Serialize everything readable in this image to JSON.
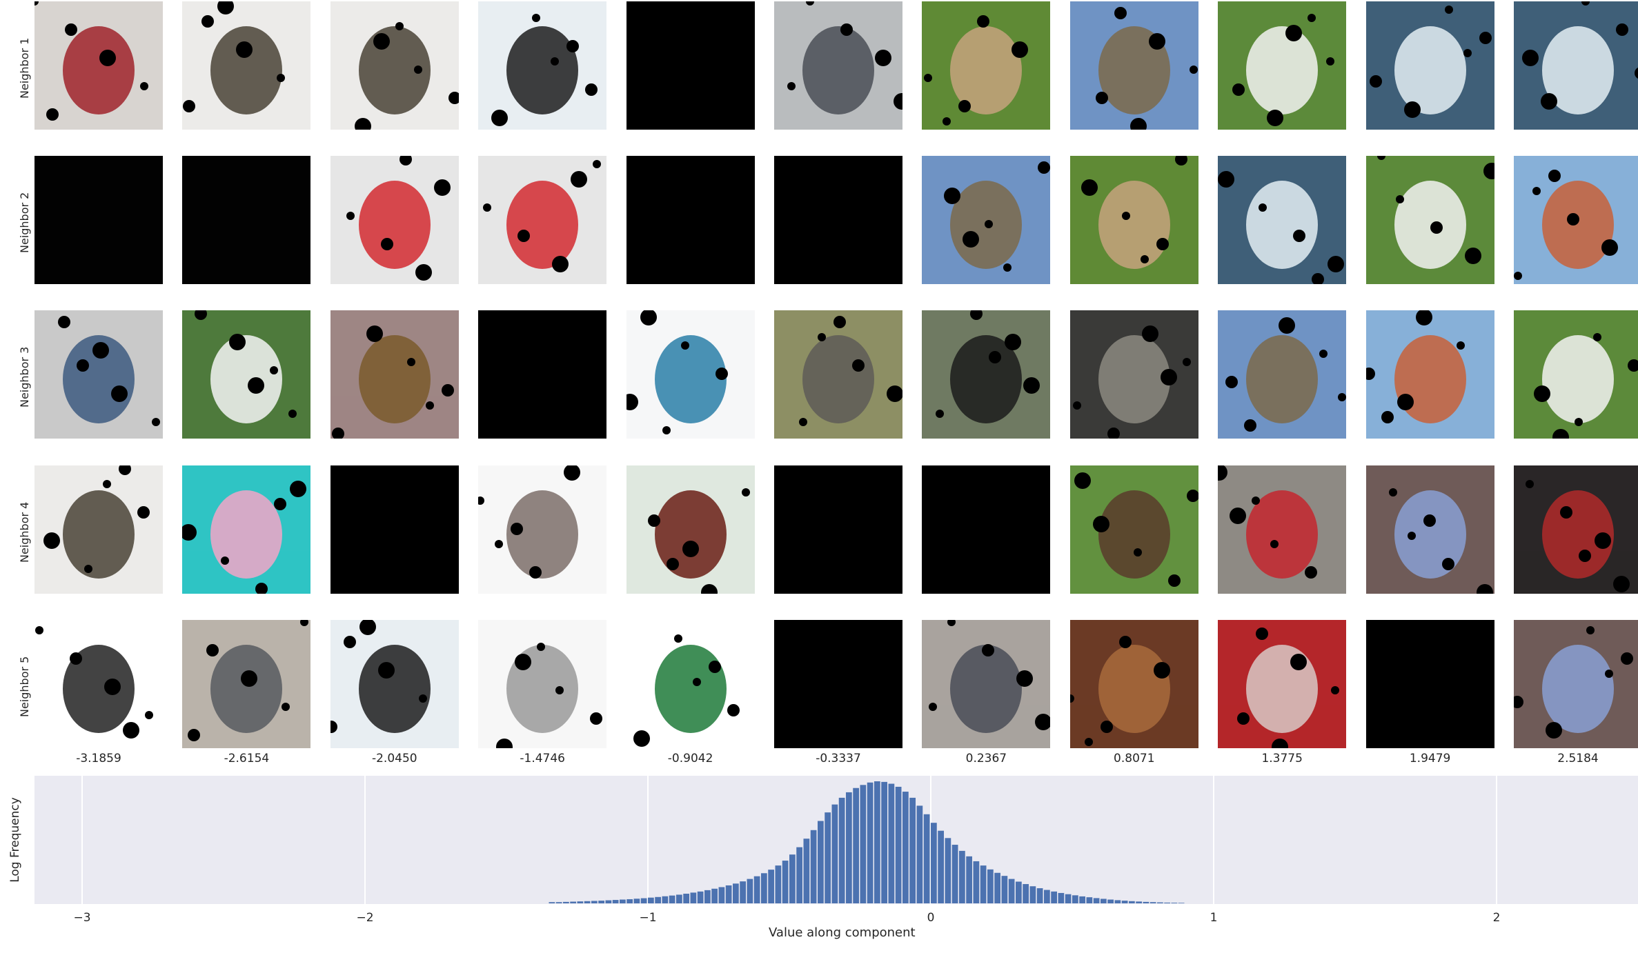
{
  "row_labels": [
    "Neighbor 1",
    "Neighbor 2",
    "Neighbor 3",
    "Neighbor 4",
    "Neighbor 5"
  ],
  "column_values": [
    "-3.1859",
    "-2.6154",
    "-2.0450",
    "-1.4746",
    "-0.9042",
    "-0.3337",
    "0.2367",
    "0.8071",
    "1.3775",
    "1.9479",
    "2.5184"
  ],
  "thumbnails": [
    [
      {
        "icon": "person-jacket-photo",
        "bg": "#d8d4d0",
        "fg": "#a0232b"
      },
      {
        "icon": "costume-figure-photo",
        "bg": "#ecebe9",
        "fg": "#4a4336"
      },
      {
        "icon": "costume-figure-photo",
        "bg": "#ecebe9",
        "fg": "#4a4336"
      },
      {
        "icon": "camera-photo",
        "bg": "#e8eef2",
        "fg": "#1d1d1f"
      },
      {
        "icon": "dark-image",
        "bg": "#000000",
        "fg": "#000000"
      },
      {
        "icon": "street-crowd-photo",
        "bg": "#b9bcbe",
        "fg": "#4a4f57"
      },
      {
        "icon": "dogs-on-grass-photo",
        "bg": "#5f8a35",
        "fg": "#c5a27c"
      },
      {
        "icon": "town-scene-photo",
        "bg": "#6f93c4",
        "fg": "#7d6a4b"
      },
      {
        "icon": "white-dog-photo",
        "bg": "#5c8a3a",
        "fg": "#f2f2f2"
      },
      {
        "icon": "waterfall-photo",
        "bg": "#3f5f78",
        "fg": "#e4eef3"
      },
      {
        "icon": "waterfall-photo",
        "bg": "#3f5f78",
        "fg": "#e4eef3"
      }
    ],
    [
      {
        "icon": "dark-image",
        "bg": "#020202",
        "fg": "#020202"
      },
      {
        "icon": "dark-image",
        "bg": "#020202",
        "fg": "#020202"
      },
      {
        "icon": "tool-package-photo",
        "bg": "#e6e6e6",
        "fg": "#d22a30"
      },
      {
        "icon": "tool-package-photo",
        "bg": "#e6e6e6",
        "fg": "#d22a30"
      },
      {
        "icon": "dark-image",
        "bg": "#000000",
        "fg": "#000000"
      },
      {
        "icon": "dark-image",
        "bg": "#000000",
        "fg": "#000000"
      },
      {
        "icon": "town-scene-photo",
        "bg": "#6f93c4",
        "fg": "#7d6a4b"
      },
      {
        "icon": "dogs-on-grass-photo",
        "bg": "#5f8a35",
        "fg": "#c5a27c"
      },
      {
        "icon": "waterfall-photo",
        "bg": "#3f5f78",
        "fg": "#e4eef3"
      },
      {
        "icon": "white-dog-photo",
        "bg": "#5c8a3a",
        "fg": "#f2f2f2"
      },
      {
        "icon": "castle-painting-photo",
        "bg": "#87b0d8",
        "fg": "#c8623a"
      }
    ],
    [
      {
        "icon": "jeans-photo",
        "bg": "#c9c9c9",
        "fg": "#3d5b80"
      },
      {
        "icon": "field-object-photo",
        "bg": "#4e7a3c",
        "fg": "#f4f4f4"
      },
      {
        "icon": "wall-texture-photo",
        "bg": "#9e8684",
        "fg": "#7a5a2c"
      },
      {
        "icon": "dark-image",
        "bg": "#000000",
        "fg": "#000000"
      },
      {
        "icon": "toolbox-photo",
        "bg": "#f6f7f8",
        "fg": "#2a7fa8"
      },
      {
        "icon": "grey-dog-field-photo",
        "bg": "#8d8f64",
        "fg": "#5e5c57"
      },
      {
        "icon": "puppy-photo",
        "bg": "#6f7a62",
        "fg": "#1c1c1c"
      },
      {
        "icon": "masked-scene-photo",
        "bg": "#3a3a38",
        "fg": "#8c8a80"
      },
      {
        "icon": "town-scene-photo",
        "bg": "#6f93c4",
        "fg": "#7d6a4b"
      },
      {
        "icon": "castle-painting-photo",
        "bg": "#87b0d8",
        "fg": "#c8623a"
      },
      {
        "icon": "white-dog-photo",
        "bg": "#5c8a3a",
        "fg": "#f2f2f2"
      }
    ],
    [
      {
        "icon": "costume-figure-photo",
        "bg": "#ecebe9",
        "fg": "#4a4336"
      },
      {
        "icon": "cassette-photo",
        "bg": "#2fc4c4",
        "fg": "#f2a6c8"
      },
      {
        "icon": "dark-image",
        "bg": "#000000",
        "fg": "#000000"
      },
      {
        "icon": "vacuum-photo",
        "bg": "#f7f7f7",
        "fg": "#7c6f6a"
      },
      {
        "icon": "wheel-object-photo",
        "bg": "#dfe8df",
        "fg": "#6b1e16"
      },
      {
        "icon": "dark-image",
        "bg": "#000000",
        "fg": "#000000"
      },
      {
        "icon": "dark-image",
        "bg": "#000000",
        "fg": "#000000"
      },
      {
        "icon": "brown-dog-photo",
        "bg": "#62913f",
        "fg": "#5a3b2b"
      },
      {
        "icon": "dog-harness-photo",
        "bg": "#8e8a84",
        "fg": "#c4262e"
      },
      {
        "icon": "blurred-texture-photo",
        "bg": "#6f5b58",
        "fg": "#8aa0d4"
      },
      {
        "icon": "locomotive-photo",
        "bg": "#2a2627",
        "fg": "#b02a2a"
      }
    ],
    [
      {
        "icon": "colour-chart-photo",
        "bg": "#ffffff",
        "fg": "#222222"
      },
      {
        "icon": "bag-photo",
        "bg": "#bab3aa",
        "fg": "#575a60"
      },
      {
        "icon": "camera-photo",
        "bg": "#e8eef2",
        "fg": "#1d1d1f"
      },
      {
        "icon": "chain-photo",
        "bg": "#f7f7f7",
        "fg": "#9a9a9a"
      },
      {
        "icon": "watch-photo",
        "bg": "#ffffff",
        "fg": "#1f7a3a"
      },
      {
        "icon": "dark-image",
        "bg": "#000000",
        "fg": "#111111"
      },
      {
        "icon": "grey-dog-snow-photo",
        "bg": "#a9a39e",
        "fg": "#4a4d57"
      },
      {
        "icon": "sitting-dog-photo",
        "bg": "#6b3a25",
        "fg": "#a86b3c"
      },
      {
        "icon": "puppy-closeup-photo",
        "bg": "#b4262a",
        "fg": "#d8c9c6"
      },
      {
        "icon": "dark-image",
        "bg": "#000000",
        "fg": "#000000"
      },
      {
        "icon": "blurred-texture-photo",
        "bg": "#6f5b58",
        "fg": "#8aa0d4"
      }
    ]
  ],
  "chart_data": {
    "type": "bar",
    "xlabel": "Value along component",
    "ylabel": "Log Frequency",
    "xlim": [
      -3.2,
      2.5
    ],
    "xticks": [
      -3,
      -2,
      -1,
      0,
      1,
      2
    ],
    "xtick_labels": [
      "−3",
      "−2",
      "−1",
      "0",
      "1",
      "2"
    ],
    "grid": true,
    "background": "#eaeaf2",
    "bar_color": "#4c72b0",
    "bins": {
      "start": -1.35,
      "width": 0.025,
      "relative_log_frequency": [
        0.01,
        0.01,
        0.012,
        0.014,
        0.016,
        0.018,
        0.02,
        0.022,
        0.025,
        0.028,
        0.031,
        0.034,
        0.038,
        0.042,
        0.047,
        0.052,
        0.058,
        0.064,
        0.071,
        0.079,
        0.088,
        0.097,
        0.108,
        0.12,
        0.133,
        0.147,
        0.162,
        0.18,
        0.2,
        0.222,
        0.247,
        0.276,
        0.31,
        0.35,
        0.4,
        0.46,
        0.53,
        0.6,
        0.675,
        0.745,
        0.81,
        0.865,
        0.91,
        0.945,
        0.97,
        0.99,
        1.0,
        0.995,
        0.98,
        0.955,
        0.915,
        0.865,
        0.8,
        0.73,
        0.66,
        0.595,
        0.535,
        0.48,
        0.43,
        0.385,
        0.345,
        0.31,
        0.278,
        0.25,
        0.225,
        0.2,
        0.178,
        0.158,
        0.14,
        0.124,
        0.11,
        0.097,
        0.085,
        0.075,
        0.066,
        0.057,
        0.05,
        0.043,
        0.037,
        0.031,
        0.026,
        0.022,
        0.018,
        0.015,
        0.012,
        0.01,
        0.008,
        0.006,
        0.005,
        0.004
      ]
    }
  }
}
